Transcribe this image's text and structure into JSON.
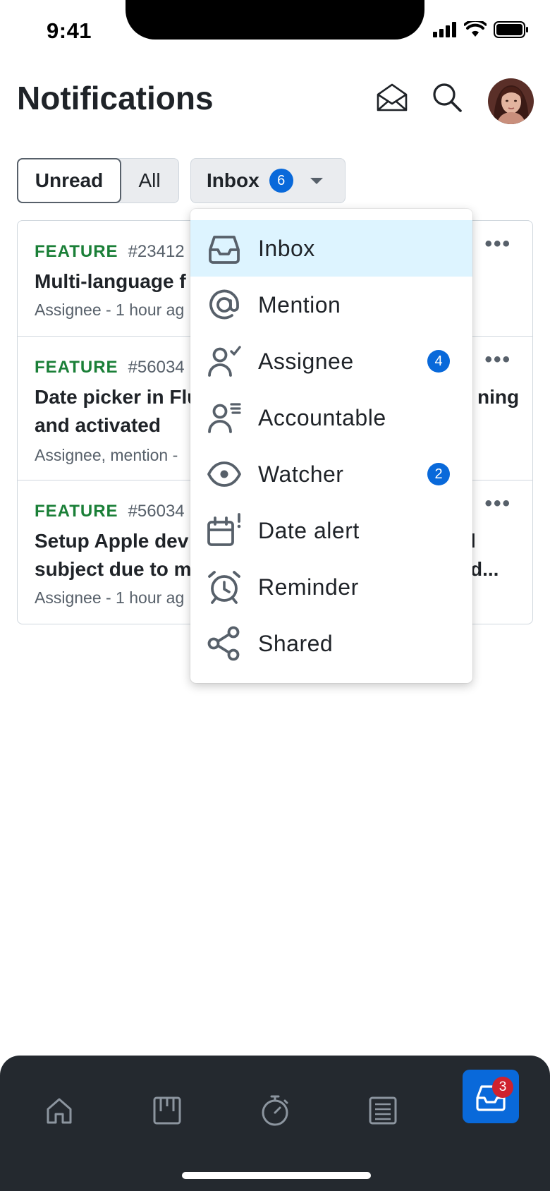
{
  "status_bar": {
    "time": "9:41"
  },
  "header": {
    "title": "Notifications",
    "icons": [
      "mark-all-read-icon",
      "search-icon",
      "avatar"
    ]
  },
  "filters": {
    "unread_label": "Unread",
    "all_label": "All",
    "inbox_label": "Inbox",
    "inbox_count": "6"
  },
  "notifications": [
    {
      "type": "FEATURE",
      "number": "#23412",
      "title_line1": "Multi-language f",
      "title_line2": "",
      "subtitle": "Assignee - 1 hour ag"
    },
    {
      "type": "FEATURE",
      "number": "#56034",
      "title_line1": "Date picker in Flu",
      "title_line1_right": "ning",
      "title_line2": "and activated",
      "subtitle": "Assignee, mention -"
    },
    {
      "type": "FEATURE",
      "number": "#56034",
      "title_line1": "Setup Apple dev",
      "title_line1_right": "l",
      "title_line2": "subject due to m",
      "title_line2_right": "d...",
      "subtitle": "Assignee - 1 hour ag"
    }
  ],
  "menu": {
    "items": [
      {
        "label": "Inbox",
        "icon": "inbox-tray-icon",
        "badge": ""
      },
      {
        "label": "Mention",
        "icon": "at-sign-icon",
        "badge": ""
      },
      {
        "label": "Assignee",
        "icon": "person-check-icon",
        "badge": "4"
      },
      {
        "label": "Accountable",
        "icon": "person-list-icon",
        "badge": ""
      },
      {
        "label": "Watcher",
        "icon": "eye-icon",
        "badge": "2"
      },
      {
        "label": "Date alert",
        "icon": "calendar-alert-icon",
        "badge": ""
      },
      {
        "label": "Reminder",
        "icon": "alarm-clock-icon",
        "badge": ""
      },
      {
        "label": "Shared",
        "icon": "share-icon",
        "badge": ""
      }
    ],
    "active_index": 0
  },
  "bottom_nav": {
    "items": [
      "home-icon",
      "board-icon",
      "stopwatch-icon",
      "list-icon",
      "inbox-icon"
    ],
    "active": "inbox-icon",
    "inbox_badge": "3"
  },
  "colors": {
    "accent": "#0969da",
    "feature_green": "#1a7f37",
    "menu_active_bg": "#ddf4ff",
    "bottom_nav_bg": "#24292f",
    "badge_red": "#cf222e"
  }
}
